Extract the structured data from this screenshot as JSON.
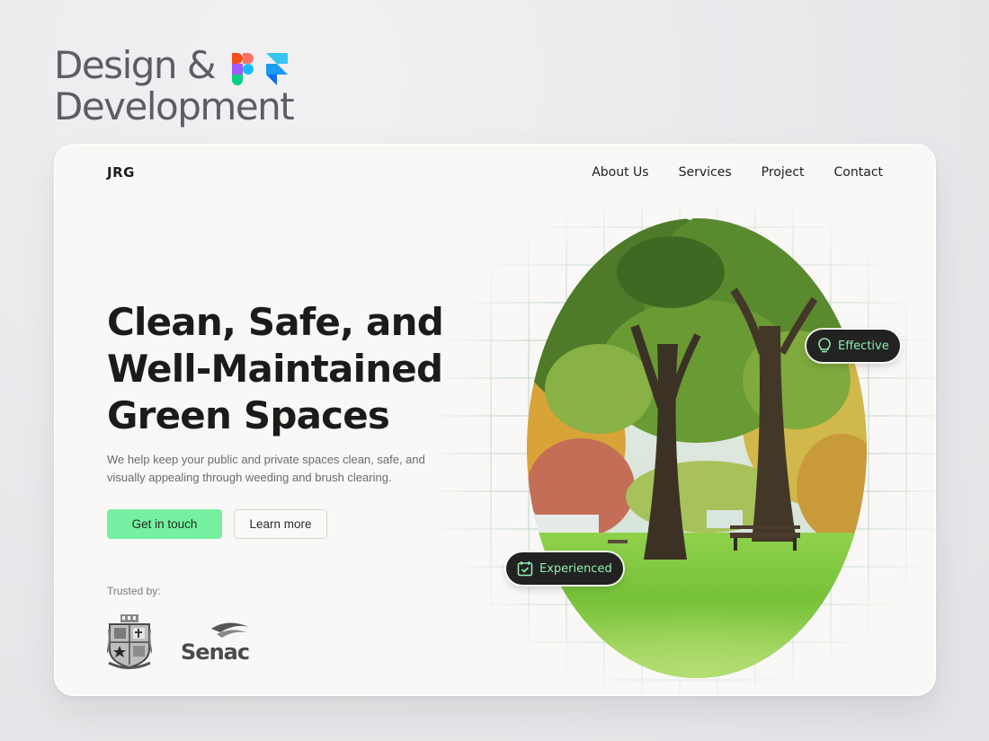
{
  "headline": {
    "line1": "Design &",
    "line2": "Development"
  },
  "tools": [
    "figma-icon",
    "framer-icon"
  ],
  "site": {
    "logo": "JRG",
    "nav": [
      "About Us",
      "Services",
      "Project",
      "Contact"
    ],
    "hero": {
      "title": [
        "Clean, Safe, and",
        "Well-Maintained",
        "Green Spaces"
      ],
      "subtitle": "We help keep your public and private spaces clean, safe, and visually appealing through weeding and brush clearing.",
      "primary_cta": "Get in touch",
      "secondary_cta": "Learn more"
    },
    "trusted": {
      "label": "Trusted by:",
      "logos": [
        "crest-logo",
        "senac-logo"
      ],
      "senac_text": "Senac"
    },
    "badges": {
      "effective": "Effective",
      "experienced": "Experienced"
    }
  },
  "colors": {
    "accent": "#76f0a0",
    "badge_bg": "#222222",
    "badge_text": "#8ff0b0",
    "heading": "#1c1b1a"
  }
}
